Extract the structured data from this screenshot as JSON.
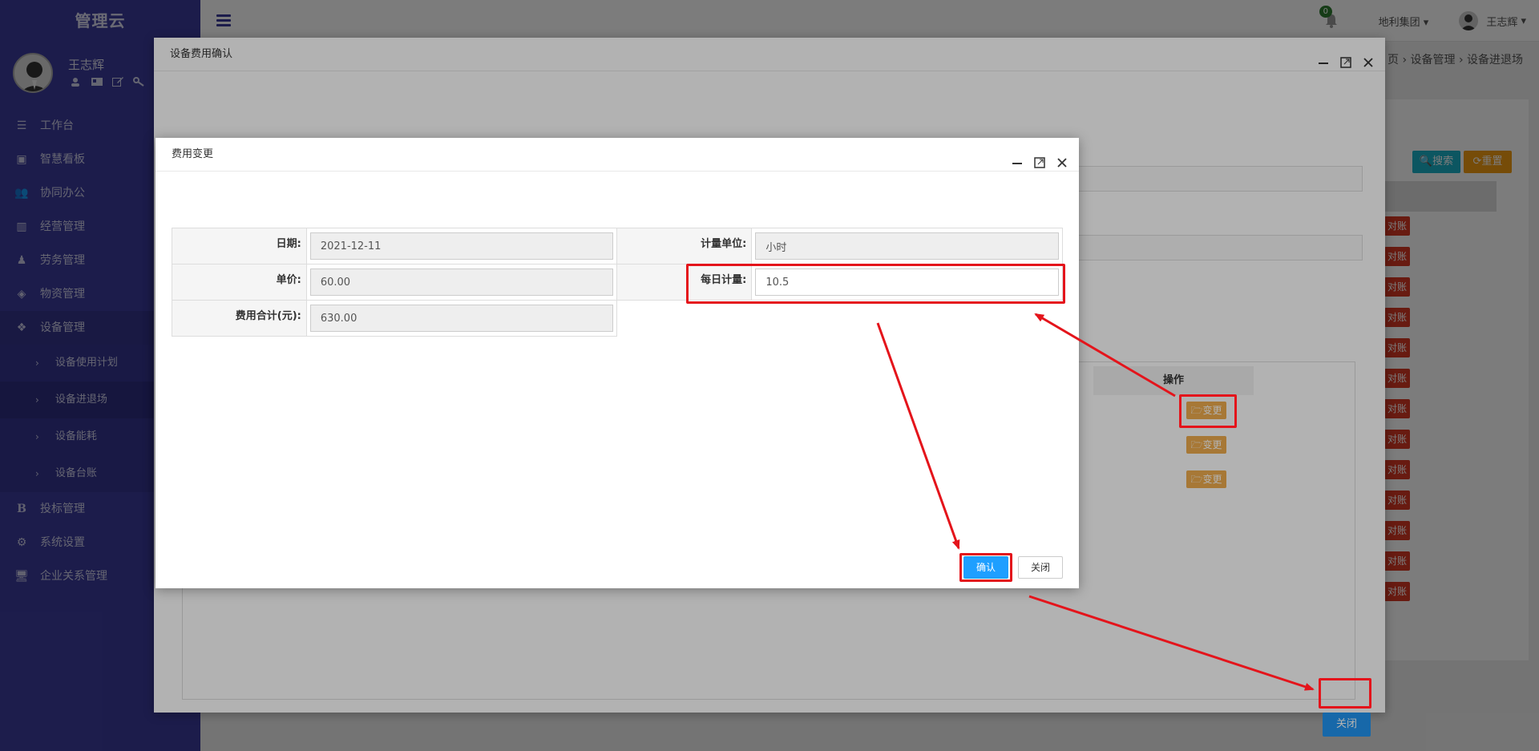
{
  "sidebar": {
    "brand": "管理云",
    "user_name": "王志辉",
    "menu": [
      {
        "label": "工作台"
      },
      {
        "label": "智慧看板"
      },
      {
        "label": "协同办公"
      },
      {
        "label": "经营管理"
      },
      {
        "label": "劳务管理"
      },
      {
        "label": "物资管理"
      },
      {
        "label": "设备管理"
      }
    ],
    "submenu": [
      {
        "label": "设备使用计划"
      },
      {
        "label": "设备进退场"
      },
      {
        "label": "设备能耗"
      },
      {
        "label": "设备台账"
      }
    ],
    "menu_bottom": [
      {
        "label": "投标管理"
      },
      {
        "label": "系统设置"
      },
      {
        "label": "企业关系管理"
      }
    ]
  },
  "navbar": {
    "notification_count": "0",
    "organization": "地利集团",
    "user_name": "王志辉",
    "breadcrumb": [
      "页",
      "设备管理",
      "设备进退场"
    ]
  },
  "page": {
    "search_label": "搜索",
    "reset_label": "重置",
    "reconcile_label": "对账",
    "reconcile_count": 13
  },
  "outer_modal": {
    "title": "设备费用确认",
    "ops_header": "操作",
    "change_label": "变更",
    "close_label": "关闭"
  },
  "inner_modal": {
    "title": "费用变更",
    "fields": {
      "date_label": "日期:",
      "date_value": "2021-12-11",
      "unit_label": "计量单位:",
      "unit_value": "小时",
      "price_label": "单价:",
      "price_value": "60.00",
      "daily_label": "每日计量:",
      "daily_value": "10.5",
      "total_label": "费用合计(元):",
      "total_value": "630.00"
    },
    "confirm_label": "确认",
    "close_label": "关闭"
  },
  "colors": {
    "sidebar_bg": "#3c3c9b",
    "primary_button": "#1e9fff",
    "warning_button": "#f0ad4e",
    "danger_button": "#d73925",
    "annotation_red": "#e4141b"
  }
}
